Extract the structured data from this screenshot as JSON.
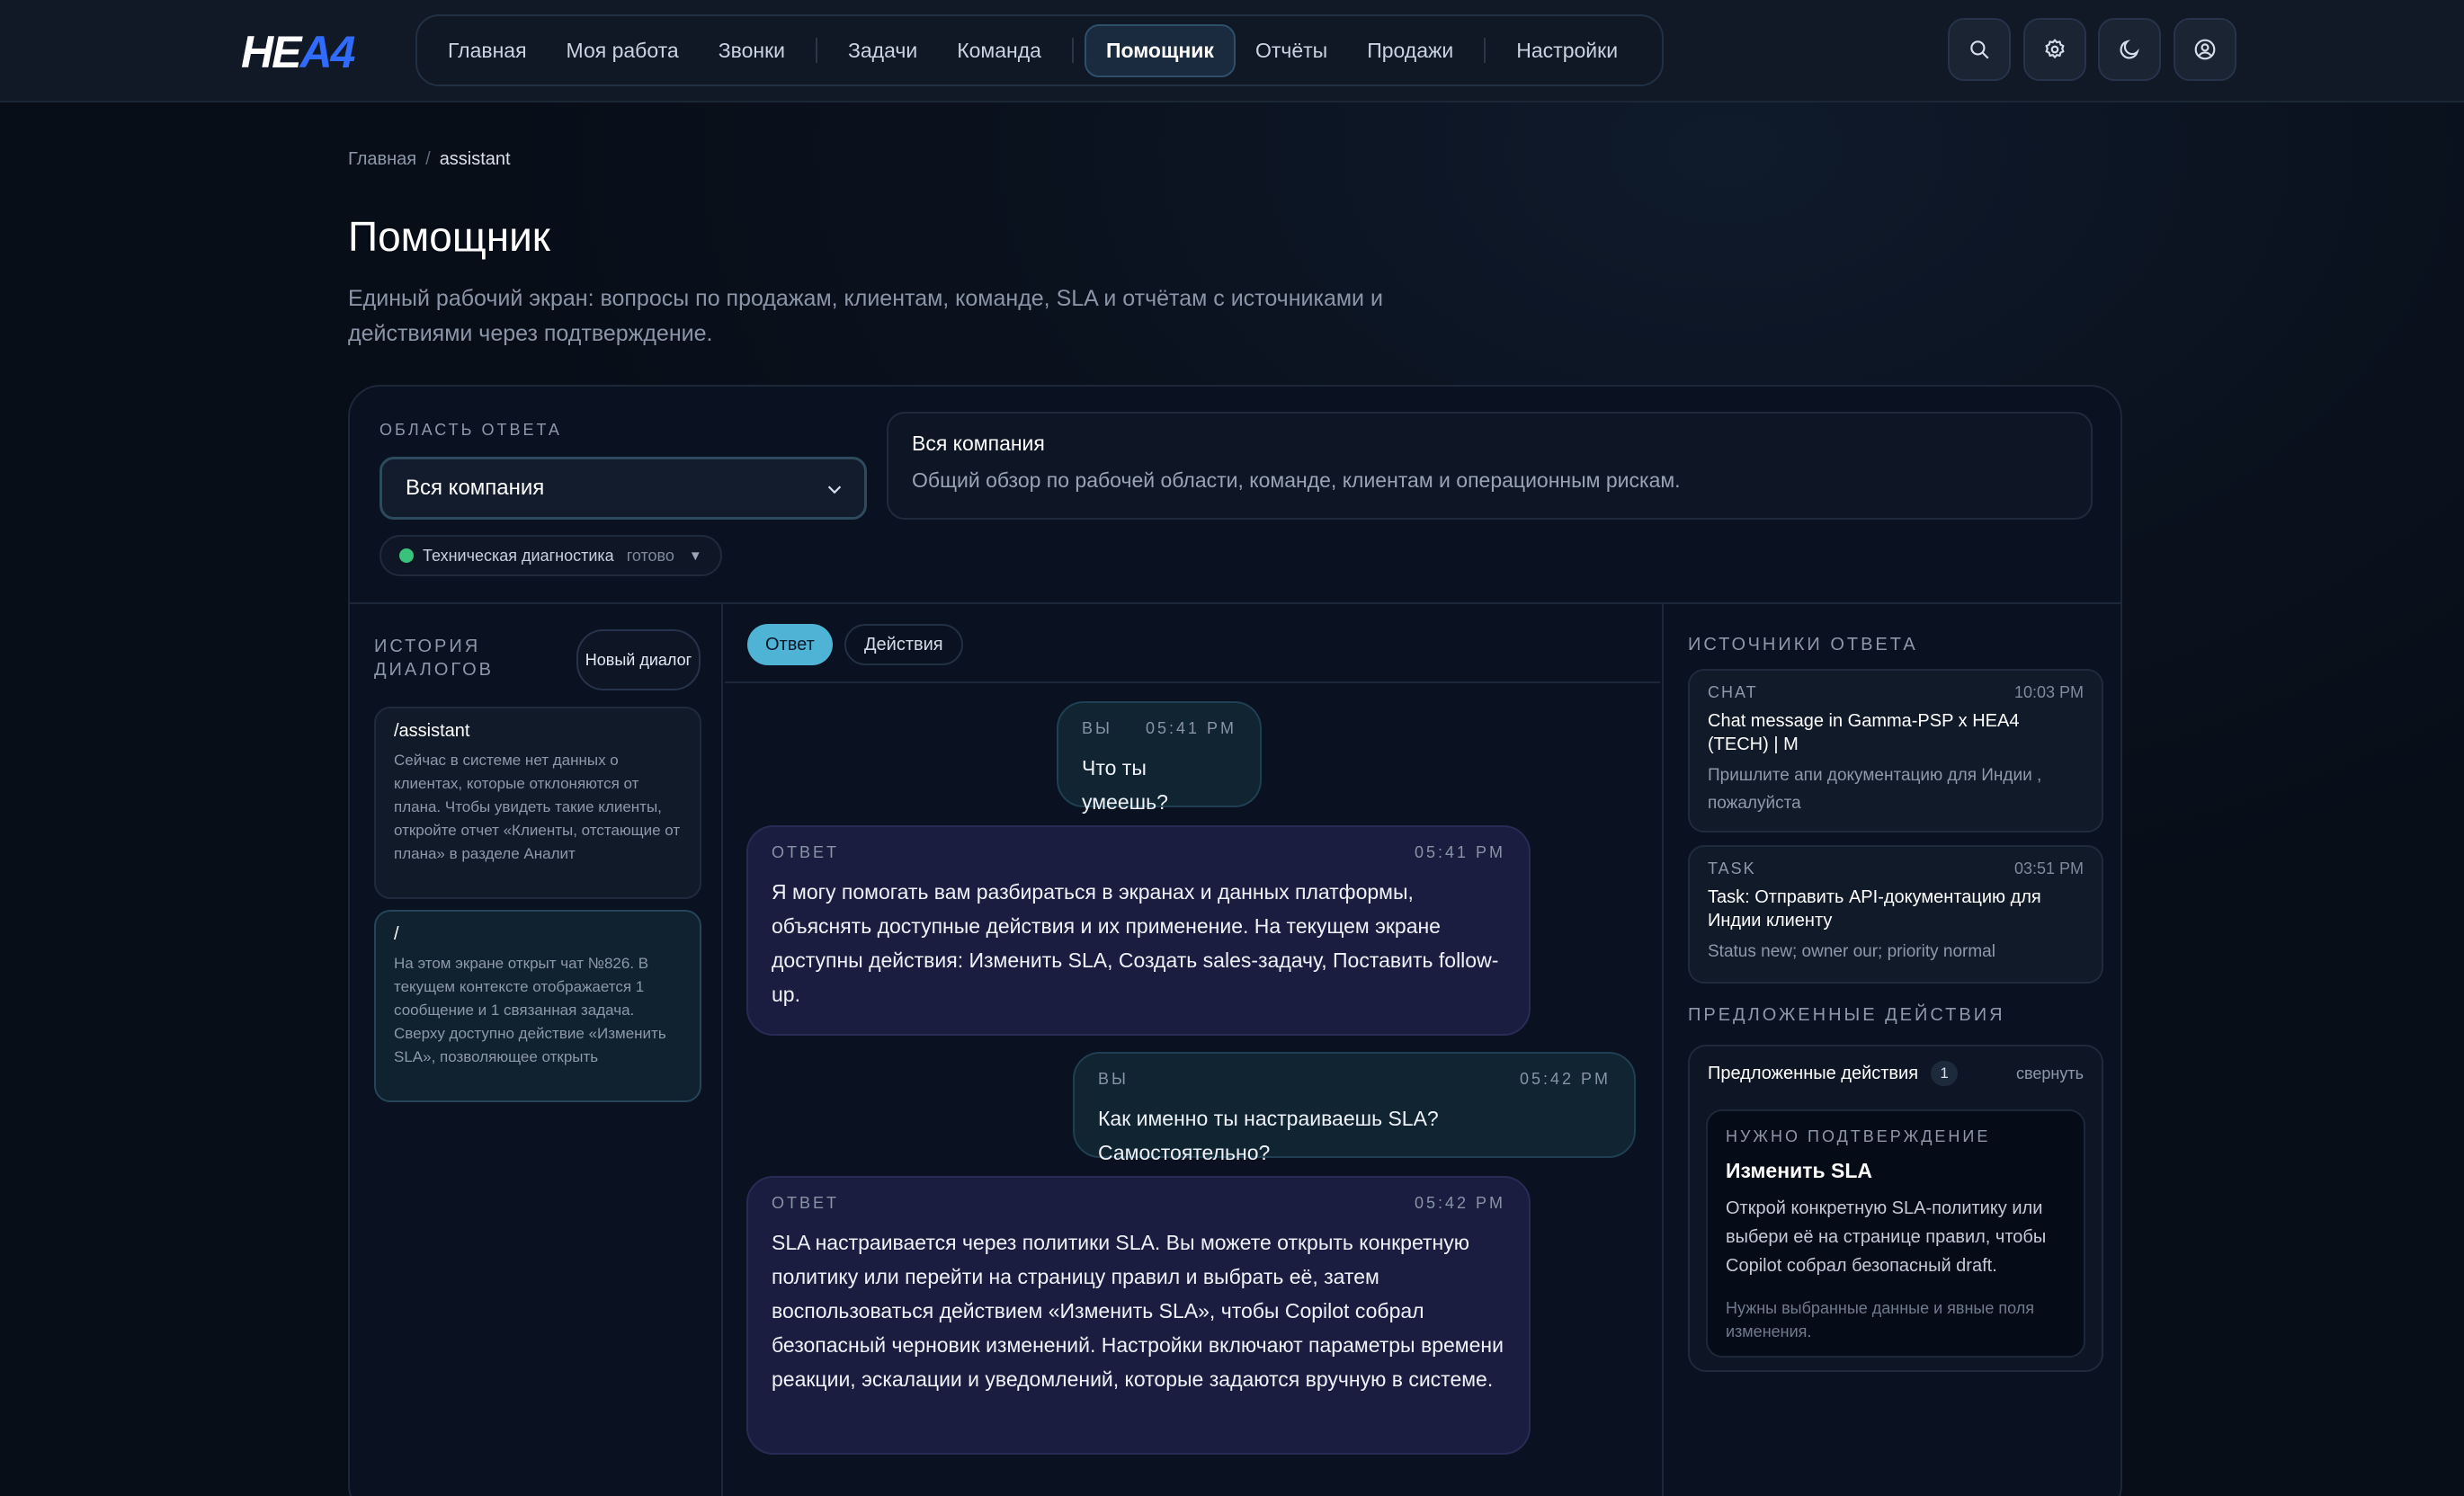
{
  "brand": {
    "logo_part1": "HE",
    "logo_part2": "A4"
  },
  "nav": {
    "items": [
      "Главная",
      "Моя работа",
      "Звонки",
      "Задачи",
      "Команда",
      "Помощник",
      "Отчёты",
      "Продажи",
      "Настройки"
    ],
    "active": "Помощник"
  },
  "header_icons": [
    "search-icon",
    "gear-icon",
    "moon-icon",
    "user-circle-icon"
  ],
  "breadcrumb": {
    "root": "Главная",
    "sep": "/",
    "current": "assistant"
  },
  "page": {
    "title": "Помощник",
    "subtitle": "Единый рабочий экран: вопросы по продажам, клиентам, команде, SLA и отчётам с источниками и действиями через подтверждение."
  },
  "scope": {
    "label": "ОБЛАСТЬ ОТВЕТА",
    "selected": "Вся компания",
    "card_title": "Вся компания",
    "card_desc": "Общий обзор по рабочей области, команде, клиентам и операционным рискам."
  },
  "diagnostics": {
    "label": "Техническая диагностика",
    "status": "готово",
    "arrow": "▼"
  },
  "history": {
    "title": "ИСТОРИЯ ДИАЛОГОВ",
    "new_button": "Новый диалог",
    "items": [
      {
        "title": "/assistant",
        "preview": "Сейчас в системе нет данных о клиентах, которые отклоняются от плана. Чтобы увидеть такие клиенты, откройте отчет «Клиенты, отстающие от плана» в разделе Аналит"
      },
      {
        "title": "/",
        "preview": "На этом экране открыт чат №826. В текущем контексте отображается 1 сообщение и 1 связанная задача. Сверху доступно действие «Изменить SLA», позволяющее открыть"
      }
    ]
  },
  "tabs": {
    "answer": "Ответ",
    "actions": "Действия"
  },
  "messages": [
    {
      "role": "ВЫ",
      "time": "05:41 PM",
      "text": "Что ты умеешь?"
    },
    {
      "role": "ОТВЕТ",
      "time": "05:41 PM",
      "text": "Я могу помогать вам разбираться в экранах и данных платформы, объяснять доступные действия и их применение. На текущем экране доступны действия: Изменить SLA, Создать sales-задачу, Поставить follow-up."
    },
    {
      "role": "ВЫ",
      "time": "05:42 PM",
      "text": "Как именно ты настраиваешь SLA? Самостоятельно?"
    },
    {
      "role": "ОТВЕТ",
      "time": "05:42 PM",
      "text": "SLA настраивается через политики SLA. Вы можете открыть конкретную политику или перейти на страницу правил и выбрать её, затем воспользоваться действием «Изменить SLA», чтобы Copilot собрал безопасный черновик изменений. Настройки включают параметры времени реакции, эскалации и уведомлений, которые задаются вручную в системе."
    }
  ],
  "sources": {
    "title": "ИСТОЧНИКИ ОТВЕТА",
    "items": [
      {
        "type": "CHAT",
        "time": "10:03 PM",
        "title": "Chat message in Gamma-PSP x HEA4 (TECH) | M",
        "desc": "Пришлите апи документацию для Индии , пожалуйста"
      },
      {
        "type": "TASK",
        "time": "03:51 PM",
        "title": "Task: Отправить API-документацию для Индии клиенту",
        "desc": "Status new; owner our; priority normal"
      }
    ]
  },
  "suggested": {
    "section_title": "ПРЕДЛОЖЕННЫЕ ДЕЙСТВИЯ",
    "header": "Предложенные действия",
    "count": "1",
    "collapse": "свернуть",
    "card": {
      "label": "НУЖНО ПОДТВЕРЖДЕНИЕ",
      "title": "Изменить SLA",
      "desc": "Открой конкретную SLA-политику или выбери её на странице правил, чтобы Copilot собрал безопасный draft.",
      "note": "Нужны выбранные данные и явные поля изменения."
    }
  },
  "colors": {
    "accent": "#4fb3d6",
    "brand_blue": "#2f6bff",
    "status_ok": "#39c37a"
  }
}
